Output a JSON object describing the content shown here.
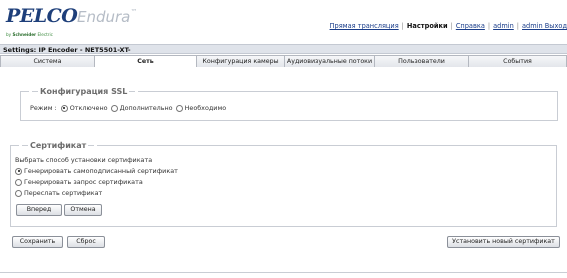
{
  "brand": {
    "pelco": "PELCO",
    "endura": "Endura",
    "trademark": "™",
    "schneider_prefix": "by",
    "schneider": "Schneider",
    "schneider_suffix": "Electric"
  },
  "topnav": {
    "items": [
      {
        "label": "Прямая трансляция",
        "active": false
      },
      {
        "label": "Настройки",
        "active": true
      },
      {
        "label": "Справка",
        "active": false
      },
      {
        "label": "admin",
        "active": false
      },
      {
        "label": "admin Выход",
        "active": false
      }
    ],
    "separator": "|"
  },
  "titlebar": {
    "text": "Settings: IP Encoder - NET5501-XT-"
  },
  "tabs": [
    {
      "label": "Система",
      "active": false
    },
    {
      "label": "Сеть",
      "active": true
    },
    {
      "label": "Конфигурация камеры",
      "active": false
    },
    {
      "label": "Аудиовизуальные потоки",
      "active": false
    },
    {
      "label": "Пользователи",
      "active": false
    },
    {
      "label": "События",
      "active": false
    }
  ],
  "ssl": {
    "legend": "Конфигурация SSL",
    "mode_label": "Режим :",
    "options": [
      {
        "label": "Отключено",
        "selected": true
      },
      {
        "label": "Дополнительно",
        "selected": false
      },
      {
        "label": "Необходимо",
        "selected": false
      }
    ]
  },
  "certificate": {
    "legend": "Сертификат",
    "prompt": "Выбрать способ установки сертификата",
    "options": [
      {
        "label": "Генерировать самоподписанный сертификат",
        "selected": true
      },
      {
        "label": "Генерировать запрос сертификата",
        "selected": false
      },
      {
        "label": "Переслать сертификат",
        "selected": false
      }
    ],
    "next_label": "Вперед",
    "cancel_label": "Отмена"
  },
  "actions": {
    "save_label": "Сохранить",
    "reset_label": "Сброс",
    "install_label": "Установить новый сертификат"
  }
}
